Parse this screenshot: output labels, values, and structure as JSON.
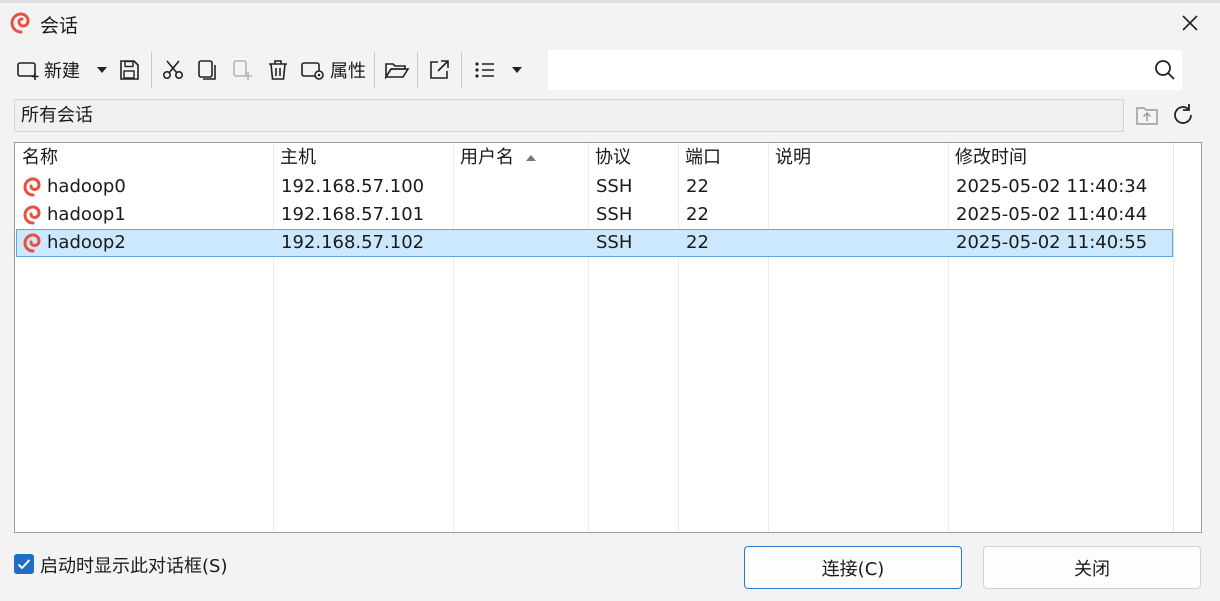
{
  "window": {
    "title": "会话"
  },
  "toolbar": {
    "new_label": "新建",
    "properties_label": "属性"
  },
  "search": {
    "placeholder": ""
  },
  "path": {
    "label": "所有会话"
  },
  "table": {
    "columns": [
      "名称",
      "主机",
      "用户名",
      "协议",
      "端口",
      "说明",
      "修改时间"
    ],
    "sort_column": "用户名",
    "rows": [
      {
        "name": "hadoop0",
        "host": "192.168.57.100",
        "user": "",
        "protocol": "SSH",
        "port": "22",
        "desc": "",
        "modified": "2025-05-02 11:40:34",
        "selected": false
      },
      {
        "name": "hadoop1",
        "host": "192.168.57.101",
        "user": "",
        "protocol": "SSH",
        "port": "22",
        "desc": "",
        "modified": "2025-05-02 11:40:44",
        "selected": false
      },
      {
        "name": "hadoop2",
        "host": "192.168.57.102",
        "user": "",
        "protocol": "SSH",
        "port": "22",
        "desc": "",
        "modified": "2025-05-02 11:40:55",
        "selected": true
      }
    ]
  },
  "footer": {
    "checkbox_label": "启动时显示此对话框(S)",
    "checkbox_checked": true,
    "connect_label": "连接(C)",
    "close_label": "关闭"
  },
  "colors": {
    "accent": "#1e6fc4",
    "selection": "#cce8ff",
    "selection_border": "#5fa8de",
    "brand_icon": "#e9503f"
  },
  "icons": [
    "app-logo-icon",
    "close-icon",
    "new-session-icon",
    "dropdown-arrow-icon",
    "save-icon",
    "cut-icon",
    "copy-icon",
    "paste-icon",
    "delete-icon",
    "properties-icon",
    "open-folder-icon",
    "export-icon",
    "list-view-icon",
    "search-icon",
    "folder-up-icon",
    "refresh-icon",
    "session-icon",
    "checkmark-icon"
  ]
}
